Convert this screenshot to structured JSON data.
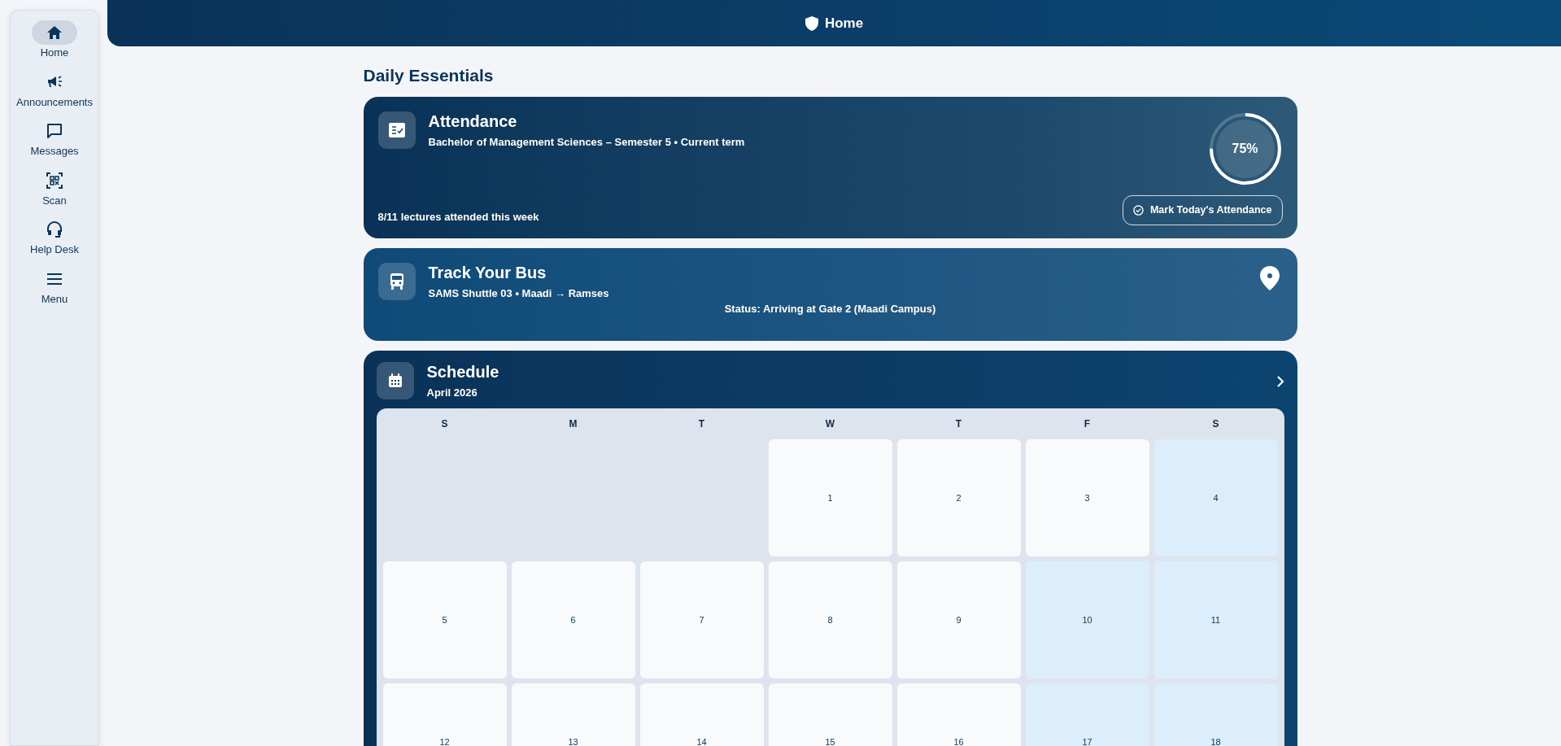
{
  "sidebar": {
    "items": [
      {
        "label": "Home",
        "selected": true
      },
      {
        "label": "Announcements",
        "selected": false
      },
      {
        "label": "Messages",
        "selected": false
      },
      {
        "label": "Scan",
        "selected": false
      },
      {
        "label": "Help Desk",
        "selected": false
      },
      {
        "label": "Menu",
        "selected": false
      }
    ]
  },
  "header": {
    "title": "Home"
  },
  "section_title": "Daily Essentials",
  "attendance": {
    "title": "Attendance",
    "subtitle": "Bachelor of Management Sciences – Semester 5 • Current term",
    "summary": "8/11 lectures attended this week",
    "percent": "75%",
    "level": 0.75,
    "button": "Mark Today's Attendance"
  },
  "bus": {
    "title": "Track Your Bus",
    "subtitle": "SAMS Shuttle 03 • Maadi → Ramses",
    "status": "Status: Arriving at Gate 2 (Maadi Campus)"
  },
  "schedule": {
    "title": "Schedule",
    "month": "April 2026",
    "weekdays": [
      "S",
      "M",
      "T",
      "W",
      "T",
      "F",
      "S"
    ],
    "days": [
      {
        "kind": "blank"
      },
      {
        "kind": "blank"
      },
      {
        "kind": "blank"
      },
      {
        "kind": "day",
        "label": "1",
        "highlighted": false
      },
      {
        "kind": "day",
        "label": "2",
        "highlighted": false
      },
      {
        "kind": "day",
        "label": "3",
        "highlighted": false
      },
      {
        "kind": "day",
        "label": "4",
        "highlighted": true
      },
      {
        "kind": "day",
        "label": "5",
        "highlighted": false
      },
      {
        "kind": "day",
        "label": "6",
        "highlighted": false
      },
      {
        "kind": "day",
        "label": "7",
        "highlighted": false
      },
      {
        "kind": "day",
        "label": "8",
        "highlighted": false
      },
      {
        "kind": "day",
        "label": "9",
        "highlighted": false
      },
      {
        "kind": "day",
        "label": "10",
        "highlighted": true
      },
      {
        "kind": "day",
        "label": "11",
        "highlighted": true
      },
      {
        "kind": "day",
        "label": "12",
        "highlighted": false
      },
      {
        "kind": "day",
        "label": "13",
        "highlighted": false
      },
      {
        "kind": "day",
        "label": "14",
        "highlighted": false
      },
      {
        "kind": "day",
        "label": "15",
        "highlighted": false
      },
      {
        "kind": "day",
        "label": "16",
        "highlighted": false
      },
      {
        "kind": "day",
        "label": "17",
        "highlighted": true
      },
      {
        "kind": "day",
        "label": "18",
        "highlighted": true
      }
    ]
  }
}
